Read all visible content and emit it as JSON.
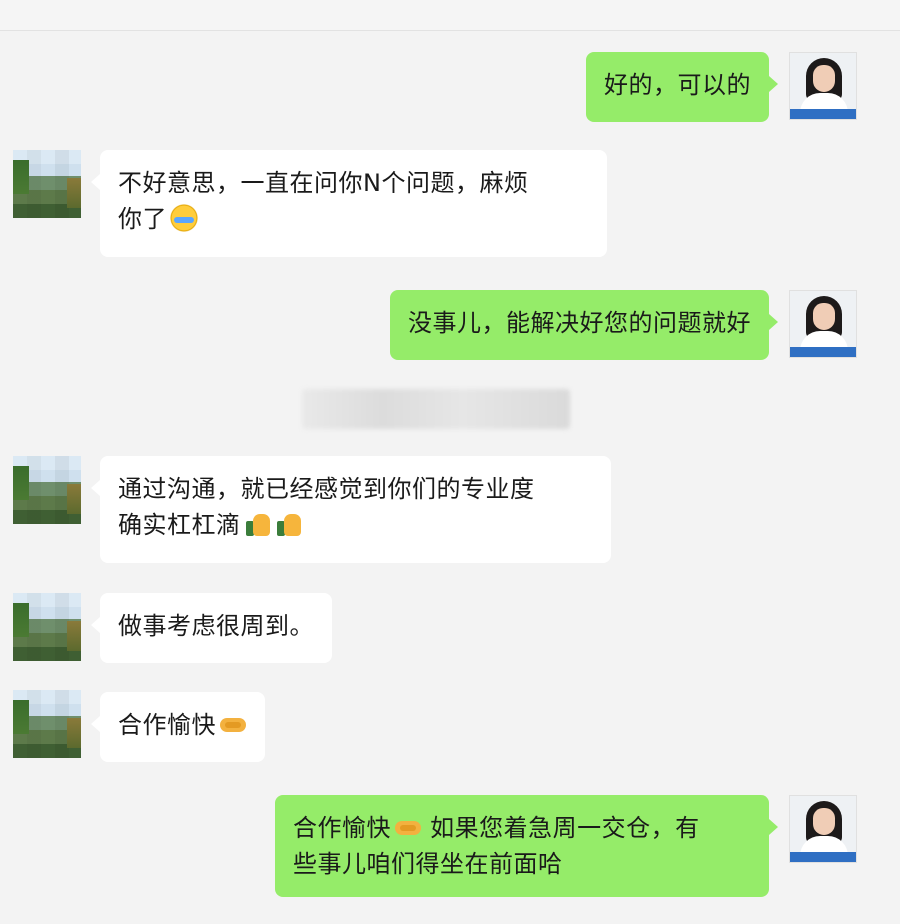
{
  "conversation": {
    "messages": [
      {
        "side": "out",
        "text": "好的，可以的"
      },
      {
        "side": "in",
        "line1": "不好意思，一直在问你N个问题，麻烦",
        "line2": "你了",
        "emoji": "crying-laughing-icon"
      },
      {
        "side": "out",
        "text": "没事儿，能解决好您的问题就好"
      },
      {
        "side": "in",
        "line1": "通过沟通，就已经感觉到你们的专业度",
        "line2": "确实杠杠滴",
        "emoji": "thumbs-up-icon"
      },
      {
        "side": "in",
        "text": "做事考虑很周到。"
      },
      {
        "side": "in",
        "text": "合作愉快",
        "emoji": "handshake-icon"
      },
      {
        "side": "out",
        "line1_a": "合作愉快",
        "line1_b": "如果您着急周一交仓，有",
        "line2": "些事儿咱们得坐在前面哈",
        "emoji": "handshake-icon"
      }
    ]
  },
  "colors": {
    "background": "#f3f3f3",
    "outgoing_bubble": "#95ec69",
    "incoming_bubble": "#ffffff",
    "avatar_bar": "#2f6fc3"
  }
}
